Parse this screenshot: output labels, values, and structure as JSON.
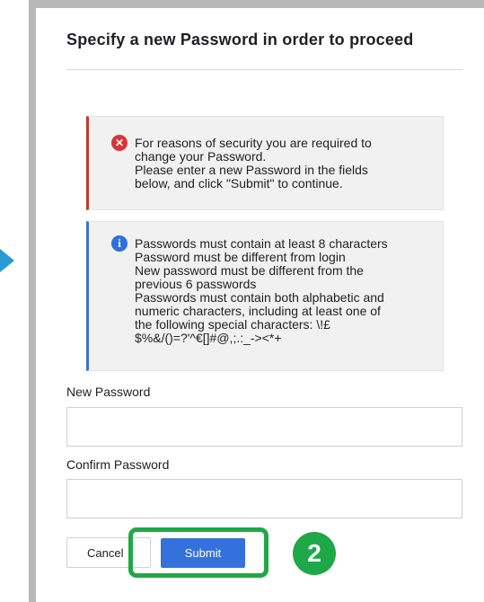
{
  "dialog": {
    "title": "Specify a new Password in order to proceed"
  },
  "error_alert": {
    "icon": "error-x-icon",
    "color": "#c0392b",
    "lines": [
      "For reasons of security you are required to",
      "change your Password.",
      "Please enter a new Password in the fields",
      "below, and click \"Submit\" to continue."
    ]
  },
  "info_alert": {
    "icon": "info-icon",
    "color": "#3b73d1",
    "lines": [
      "Passwords must contain at least 8 characters",
      "Password must be different from login",
      "New password must be different from the",
      "previous 6 passwords",
      "Passwords must contain both alphabetic and",
      "numeric characters, including at least one of",
      "the following special characters: \\!£",
      "$%&/()=?'^€[]#@,;.:_-><*+"
    ]
  },
  "form": {
    "new_password_label": "New Password",
    "new_password_value": "",
    "confirm_password_label": "Confirm Password",
    "confirm_password_value": ""
  },
  "buttons": {
    "cancel_label": "Cancel",
    "submit_label": "Submit"
  },
  "annotation": {
    "step_number": "2",
    "color": "#1fa847"
  },
  "colors": {
    "submit_button": "#3571dc",
    "frame": "#b7b7b7",
    "pointer_arrow": "#2b9bd3"
  }
}
